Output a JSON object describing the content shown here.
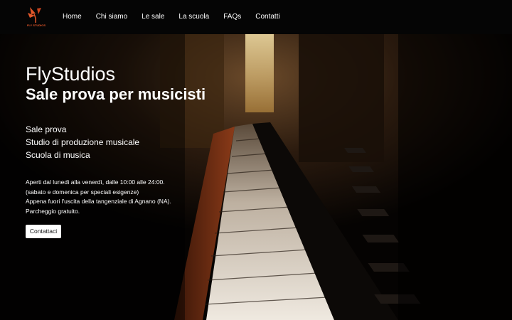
{
  "brand": {
    "logo_text": "FLY STUDIOS",
    "accent_color": "#e2572a"
  },
  "nav": {
    "items": [
      "Home",
      "Chi siamo",
      "Le sale",
      "La scuola",
      "FAQs",
      "Contatti"
    ]
  },
  "hero": {
    "title": "FlyStudios",
    "subtitle": "Sale prova per musicisti",
    "services": [
      "Sale prova",
      "Studio di produzione musicale",
      "Scuola di musica"
    ],
    "info": [
      "Aperti dal lunedì alla venerdì, dalle 10:00 alle 24:00.",
      "(sabato e domenica per speciali esigenze)",
      "Appena fuori l'uscita della tangenziale di Agnano (NA).",
      "Parcheggio gratuito."
    ],
    "cta_label": "Contattaci",
    "background_image": "piano keyboard"
  }
}
